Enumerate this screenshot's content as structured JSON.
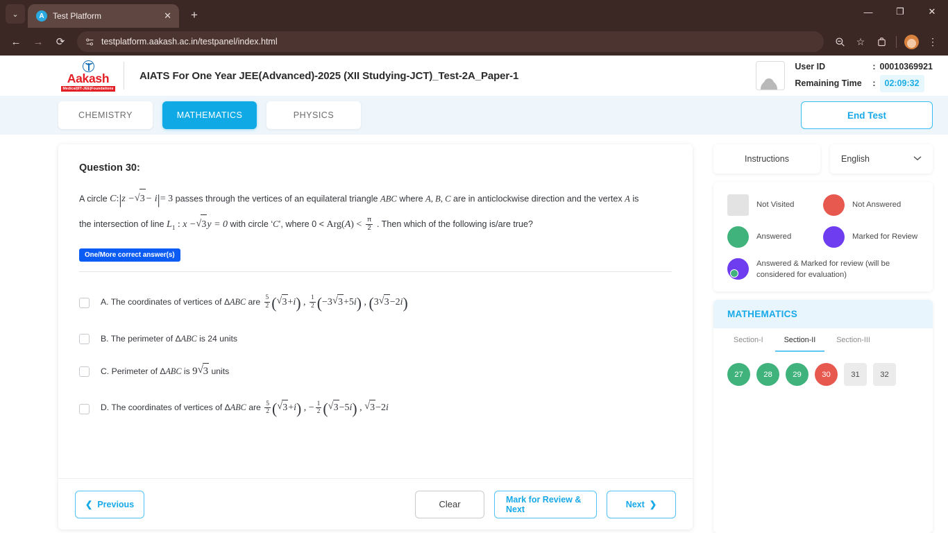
{
  "browser": {
    "tab_title": "Test Platform",
    "tab_close": "✕",
    "new_tab": "+",
    "tab_list_caret": "⌄",
    "favicon_letter": "A",
    "back": "←",
    "forward": "→",
    "reload": "⟳",
    "url": "testplatform.aakash.ac.in/testpanel/index.html",
    "zoom_out_icon": "⊖",
    "bookmark_icon": "☆",
    "extensions_icon": "⛊",
    "menu_icon": "⋮",
    "minimize": "—",
    "maximize": "❐",
    "close": "✕"
  },
  "header": {
    "logo_text": "Aakash",
    "logo_sub": "Medical|IIT-JEE|Foundations",
    "exam_title": "AIATS For One Year JEE(Advanced)-2025 (XII Studying-JCT)_Test-2A_Paper-1",
    "user_id_label": "User ID",
    "user_id_value": "00010369921",
    "remaining_label": "Remaining Time",
    "remaining_value": "02:09:32",
    "colon": ":"
  },
  "subjects": {
    "tabs": [
      {
        "label": "CHEMISTRY",
        "active": false
      },
      {
        "label": "MATHEMATICS",
        "active": true
      },
      {
        "label": "PHYSICS",
        "active": false
      }
    ],
    "end_test": "End Test"
  },
  "question": {
    "number_label": "Question 30:",
    "answer_type_badge": "One/More correct answer(s)",
    "text_parts": {
      "p1": "A circle",
      "c_sym": "C",
      "colon": ":",
      "z_minus": "z −",
      "sqrt3_a": "3",
      "minus_i": "− i",
      "equals3": "= 3",
      "p2": "passes through the vertices of an equilateral triangle",
      "abc": "ABC",
      "p3": "where",
      "a_b_c": "A, B, C",
      "p4": "are in anticlockwise direction and the vertex",
      "vertex_a": "A",
      "p5": "is the intersection of line",
      "l1": "L",
      "l1_sub": "1",
      "l1_colon": ":",
      "x_minus": "x −",
      "sqrt3_b": "3",
      "y_eq0": "y = 0",
      "p6": "with circle ‘",
      "c2": "C",
      "p7": "’, where 0 <",
      "arg": "Arg(",
      "arg_a": "A",
      "arg_close": ") <",
      "pi_num": "π",
      "pi_den": "2",
      "p8": ". Then which of the following is/are true?"
    },
    "options": [
      {
        "letter": "A.",
        "lead": "The coordinates of vertices of Δ",
        "abc": "ABC",
        "mid": "are",
        "checked": false,
        "math": "52(√3+i) , 12(−3√3+5i) , (3√3−2i)"
      },
      {
        "letter": "B.",
        "lead": "The perimeter of Δ",
        "abc": "ABC",
        "mid": "is 24 units",
        "checked": false,
        "math": ""
      },
      {
        "letter": "C.",
        "lead": "Perimeter of Δ",
        "abc": "ABC",
        "mid": "is",
        "checked": false,
        "math": "9√3 units"
      },
      {
        "letter": "D.",
        "lead": "The coordinates of vertices of Δ",
        "abc": "ABC",
        "mid": "are",
        "checked": false,
        "math": "52(√3+i) , −12(√3−5i) , √3−2i"
      }
    ]
  },
  "footer": {
    "previous": "Previous",
    "previous_icon": "❮",
    "clear": "Clear",
    "mark_review_next": "Mark for Review & Next",
    "next": "Next",
    "next_icon": "❯"
  },
  "rail": {
    "instructions": "Instructions",
    "language": "English",
    "language_caret": "⌄",
    "legend": [
      {
        "label": "Not Visited",
        "style": "square",
        "color": "#e3e3e3"
      },
      {
        "label": "Not Answered",
        "style": "circle red",
        "color": "#e7584f"
      },
      {
        "label": "Answered",
        "style": "circle green",
        "color": "#40b37c"
      },
      {
        "label": "Marked for Review",
        "style": "circle purple",
        "color": "#6f3df0"
      },
      {
        "label": "Answered & Marked for review (will be considered for evaluation)",
        "style": "circle combo",
        "color": "#6f3df0"
      }
    ],
    "palette_title": "MATHEMATICS",
    "sections": [
      {
        "label": "Section-I",
        "active": false
      },
      {
        "label": "Section-II",
        "active": true
      },
      {
        "label": "Section-III",
        "active": false
      }
    ],
    "questions": [
      {
        "num": "27",
        "state": "answered"
      },
      {
        "num": "28",
        "state": "answered"
      },
      {
        "num": "29",
        "state": "answered"
      },
      {
        "num": "30",
        "state": "notanswered"
      },
      {
        "num": "31",
        "state": "notvisited"
      },
      {
        "num": "32",
        "state": "notvisited"
      }
    ]
  },
  "colors": {
    "accent": "#17a9e8",
    "active_tab": "#0fa9e6",
    "badge_blue": "#0a5cf5",
    "answered": "#40b37c",
    "not_answered": "#e7584f",
    "marked": "#6f3df0",
    "not_visited": "#e3e3e3",
    "brand_red": "#e31e24"
  }
}
